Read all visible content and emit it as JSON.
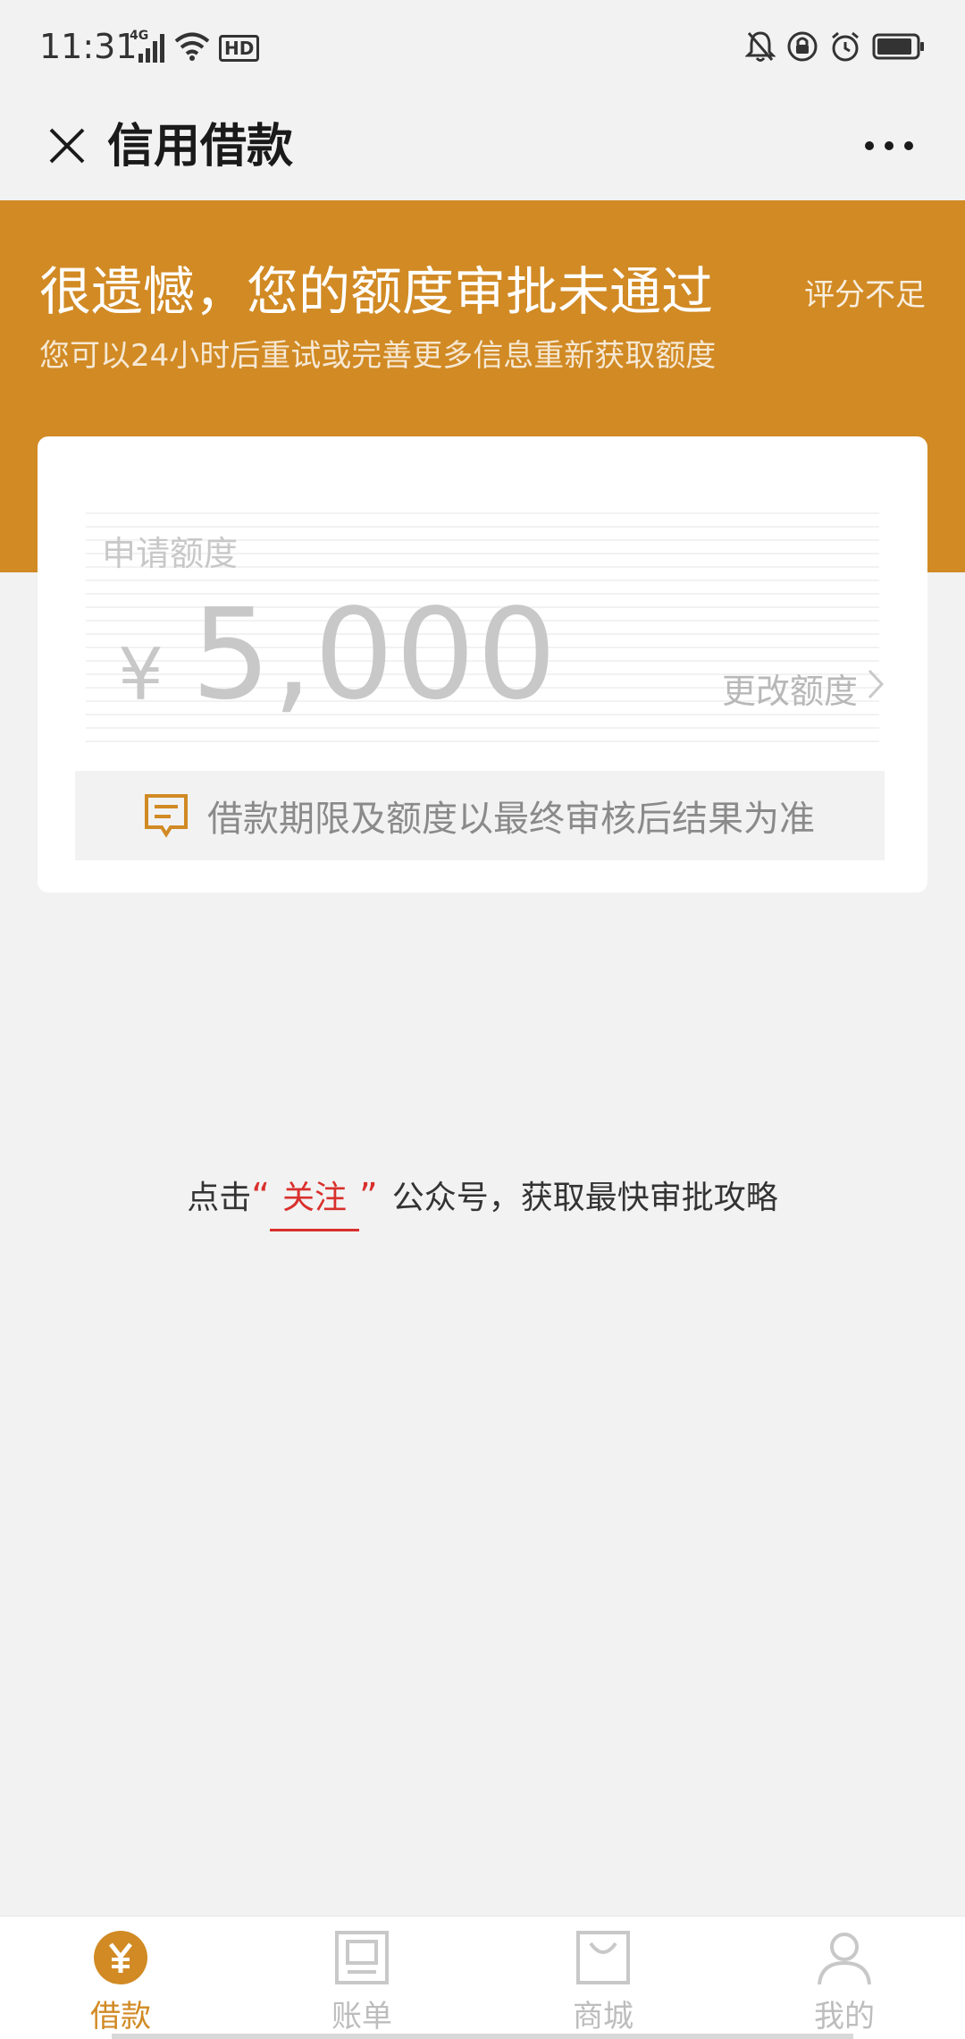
{
  "status_bar": {
    "time": "11:31",
    "network": "4G",
    "hd_badge": "HD",
    "icons": [
      "signal-icon",
      "wifi-icon",
      "hd-icon",
      "bell-off-icon",
      "lock-rotation-icon",
      "alarm-icon",
      "battery-icon"
    ]
  },
  "title_bar": {
    "title": "信用借款"
  },
  "header": {
    "title": "很遗憾，您的额度审批未通过",
    "tag": "评分不足",
    "subtitle": "您可以24小时后重试或完善更多信息重新获取额度"
  },
  "card": {
    "amount_label": "申请额度",
    "currency": "¥",
    "amount": "5,000",
    "change_label": "更改额度",
    "notice": "借款期限及额度以最终审核后结果为准"
  },
  "follow": {
    "prefix": "点击",
    "open_quote": "“",
    "link": "关注",
    "close_quote": "”",
    "suffix": "公众号，获取最快审批攻略"
  },
  "bottom_nav": {
    "items": [
      {
        "label": "借款",
        "icon": "yen-circle-icon",
        "active": true
      },
      {
        "label": "账单",
        "icon": "bill-icon",
        "active": false
      },
      {
        "label": "商城",
        "icon": "shopping-bag-icon",
        "active": false
      },
      {
        "label": "我的",
        "icon": "user-icon",
        "active": false
      }
    ]
  },
  "colors": {
    "accent": "#d18a24",
    "link": "#d9302c",
    "background": "#f2f2f2"
  }
}
